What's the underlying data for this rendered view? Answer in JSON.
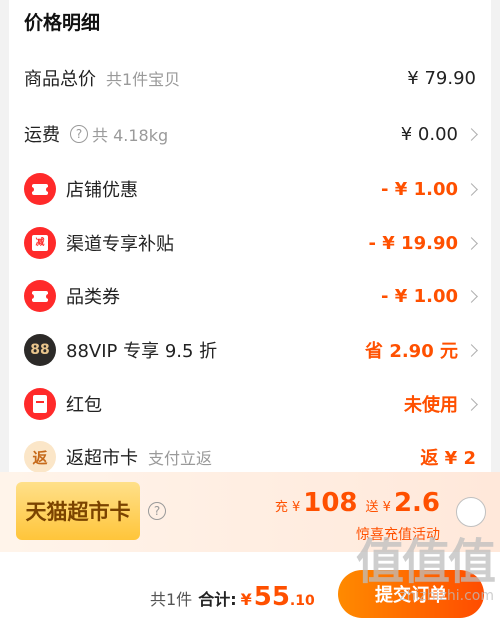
{
  "title": "价格明细",
  "rows": [
    {
      "label": "商品总价",
      "note": "共1件宝贝",
      "value": "¥ 79.90"
    },
    {
      "label": "运费",
      "note": "共 4.18kg",
      "value": "¥ 0.00"
    },
    {
      "label": "店铺优惠",
      "value": "- ¥ 1.00"
    },
    {
      "label": "渠道专享补贴",
      "value": "- ¥ 19.90",
      "icon_text": "减"
    },
    {
      "label": "品类券",
      "value": "- ¥ 1.00"
    },
    {
      "label": "88VIP 专享 9.5 折",
      "value": "省 2.90 元",
      "icon_text": "88"
    },
    {
      "label": "红包",
      "value": "未使用"
    },
    {
      "label": "返超市卡",
      "note": "支付立返",
      "value": "返 ¥ 2",
      "icon_text": "返"
    }
  ],
  "banner": {
    "tag": "天猫超市卡",
    "help": "?",
    "offer_prefix": "充 ¥",
    "offer_amount": "108",
    "offer_mid": "送 ¥",
    "offer_bonus": "2.6",
    "subtitle": "惊喜充值活动"
  },
  "footer": {
    "count": "共1件",
    "total_label": "合计:",
    "currency": "¥",
    "total_int": "55",
    "total_dec": ".10",
    "submit": "提交订单"
  },
  "watermark": {
    "logo": "值值值",
    "url": "zhizhizhi.com"
  },
  "colors": {
    "accent": "#ff5000",
    "icon_red": "#ff2a2a"
  }
}
